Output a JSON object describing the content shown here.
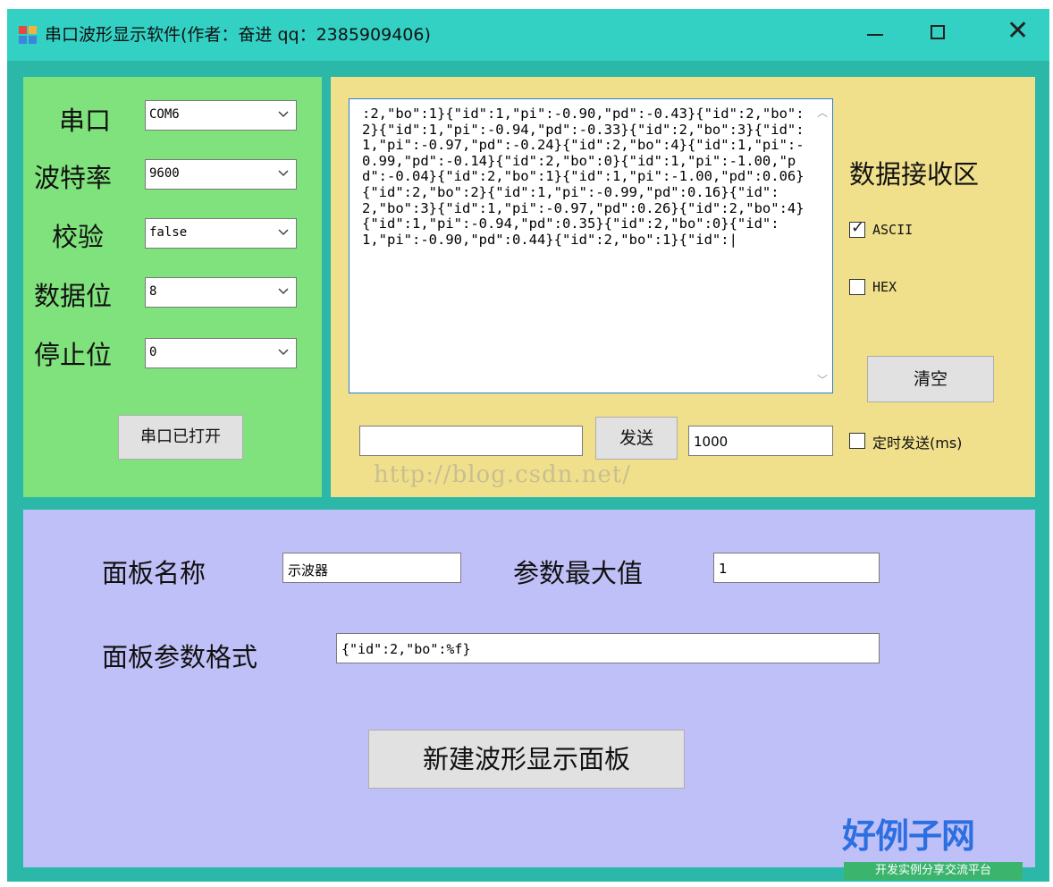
{
  "window": {
    "title": "串口波形显示软件(作者：奋进 qq：2385909406)",
    "minimize_glyph": "—",
    "maximize_glyph": "☐",
    "close_glyph": "✕"
  },
  "serial": {
    "port_label": "串口",
    "port_value": "COM6",
    "baud_label": "波特率",
    "baud_value": "9600",
    "parity_label": "校验",
    "parity_value": "false",
    "databits_label": "数据位",
    "databits_value": "8",
    "stopbits_label": "停止位",
    "stopbits_value": "0",
    "open_button": "串口已打开"
  },
  "receive": {
    "text": ":2,\"bo\":1}{\"id\":1,\"pi\":-0.90,\"pd\":-0.43}{\"id\":2,\"bo\":2}{\"id\":1,\"pi\":-0.94,\"pd\":-0.33}{\"id\":2,\"bo\":3}{\"id\":1,\"pi\":-0.97,\"pd\":-0.24}{\"id\":2,\"bo\":4}{\"id\":1,\"pi\":-0.99,\"pd\":-0.14}{\"id\":2,\"bo\":0}{\"id\":1,\"pi\":-1.00,\"pd\":-0.04}{\"id\":2,\"bo\":1}{\"id\":1,\"pi\":-1.00,\"pd\":0.06}{\"id\":2,\"bo\":2}{\"id\":1,\"pi\":-0.99,\"pd\":0.16}{\"id\":2,\"bo\":3}{\"id\":1,\"pi\":-0.97,\"pd\":0.26}{\"id\":2,\"bo\":4}{\"id\":1,\"pi\":-0.94,\"pd\":0.35}{\"id\":2,\"bo\":0}{\"id\":1,\"pi\":-0.90,\"pd\":0.44}{\"id\":2,\"bo\":1}{\"id\":|",
    "area_label": "数据接收区",
    "ascii_label": "ASCII",
    "ascii_checked": true,
    "hex_label": "HEX",
    "hex_checked": false,
    "clear_button": "清空",
    "send_input_value": "",
    "send_button": "发送",
    "interval_value": "1000",
    "timed_send_label": "定时发送(ms)",
    "timed_send_checked": false
  },
  "panel": {
    "name_label": "面板名称",
    "name_value": "示波器",
    "max_label": "参数最大值",
    "max_value": "1",
    "format_label": "面板参数格式",
    "format_value": "{\"id\":2,\"bo\":%f}",
    "create_button": "新建波形显示面板"
  },
  "watermark": {
    "url": "http://blog.csdn.net/",
    "logo_main": "好例子网",
    "logo_sub": "开发实例分享交流平台"
  },
  "colors": {
    "window_frame": "#2cb8a8",
    "titlebar": "#33d1c4",
    "serial_panel": "#80e27c",
    "receive_panel": "#f0e08c",
    "waveform_panel": "#c0c0f8",
    "button_face": "#e1e1e1",
    "logo_blue": "#2c6fe0",
    "logo_green": "#3bb46e"
  },
  "icons": {
    "app": "app-window-icon",
    "dropdown": "chevron-down-icon",
    "check": "checkmark-icon"
  }
}
